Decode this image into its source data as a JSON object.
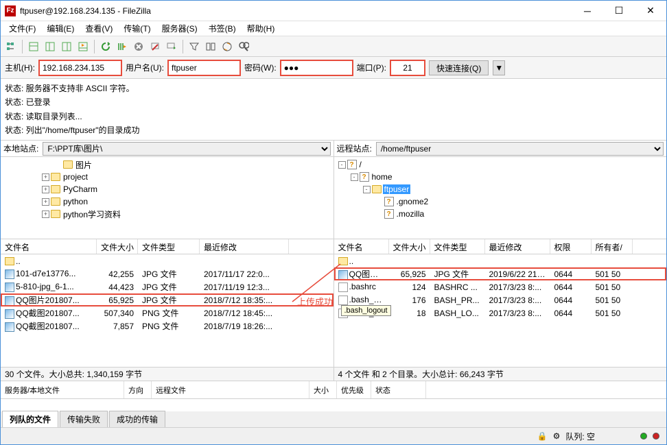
{
  "title": "ftpuser@192.168.234.135 - FileZilla",
  "menu": [
    "文件(F)",
    "编辑(E)",
    "查看(V)",
    "传输(T)",
    "服务器(S)",
    "书签(B)",
    "帮助(H)"
  ],
  "qc": {
    "host_label": "主机(H):",
    "host": "192.168.234.135",
    "user_label": "用户名(U):",
    "user": "ftpuser",
    "pass_label": "密码(W):",
    "pass": "●●●",
    "port_label": "端口(P):",
    "port": "21",
    "connect": "快速连接(Q)"
  },
  "log": [
    "状态:\t服务器不支持非 ASCII 字符。",
    "状态:\t已登录",
    "状态:\t读取目录列表...",
    "状态:\t列出\"/home/ftpuser\"的目录成功"
  ],
  "local_site_label": "本地站点:",
  "local_site": "F:\\PPT库\\图片\\",
  "remote_site_label": "远程站点:",
  "remote_site": "/home/ftpuser",
  "local_tree": [
    {
      "indent": 4,
      "exp": "",
      "label": "图片"
    },
    {
      "indent": 3,
      "exp": "+",
      "label": "project"
    },
    {
      "indent": 3,
      "exp": "+",
      "label": "PyCharm"
    },
    {
      "indent": 3,
      "exp": "+",
      "label": "python"
    },
    {
      "indent": 3,
      "exp": "+",
      "label": "python学习资料"
    }
  ],
  "remote_tree": [
    {
      "indent": 0,
      "exp": "-",
      "icon": "q",
      "label": "/"
    },
    {
      "indent": 1,
      "exp": "-",
      "icon": "q",
      "label": "home"
    },
    {
      "indent": 2,
      "exp": "-",
      "icon": "f",
      "label": "ftpuser",
      "selected": true
    },
    {
      "indent": 3,
      "exp": "",
      "icon": "q",
      "label": ".gnome2"
    },
    {
      "indent": 3,
      "exp": "",
      "icon": "q",
      "label": ".mozilla"
    }
  ],
  "lcols": [
    "文件名",
    "文件大小",
    "文件类型",
    "最近修改"
  ],
  "rcols": [
    "文件名",
    "文件大小",
    "文件类型",
    "最近修改",
    "权限",
    "所有者/"
  ],
  "lfiles": [
    {
      "up": true,
      "name": ".."
    },
    {
      "name": "101-d7e13776...",
      "size": "42,255",
      "type": "JPG 文件",
      "mod": "2017/11/17 22:0..."
    },
    {
      "name": "5-810-jpg_6-1...",
      "size": "44,423",
      "type": "JPG 文件",
      "mod": "2017/11/19 12:3..."
    },
    {
      "name": "QQ图片201807...",
      "size": "65,925",
      "type": "JPG 文件",
      "mod": "2018/7/12 18:35:...",
      "hl": true
    },
    {
      "name": "QQ截图201807...",
      "size": "507,340",
      "type": "PNG 文件",
      "mod": "2018/7/12 18:45:..."
    },
    {
      "name": "QQ截图201807...",
      "size": "7,857",
      "type": "PNG 文件",
      "mod": "2018/7/19 18:26:..."
    }
  ],
  "lstatus": "30 个文件。大小总共: 1,340,159 字节",
  "rfiles": [
    {
      "up": true,
      "name": ".."
    },
    {
      "name": "QQ图片...",
      "size": "65,925",
      "type": "JPG 文件",
      "mod": "2019/6/22 21:...",
      "perm": "0644",
      "own": "501 50",
      "hl": true
    },
    {
      "name": ".bashrc",
      "size": "124",
      "type": "BASHRC ...",
      "mod": "2017/3/23 8:...",
      "perm": "0644",
      "own": "501 50"
    },
    {
      "name": ".bash_p...",
      "size": "176",
      "type": "BASH_PR...",
      "mod": "2017/3/23 8:...",
      "perm": "0644",
      "own": "501 50"
    },
    {
      "name": ".bash_logout",
      "size": "18",
      "type": "BASH_LO...",
      "mod": "2017/3/23 8:...",
      "perm": "0644",
      "own": "501 50",
      "tooltip": ".bash_logout"
    }
  ],
  "rstatus": "4 个文件 和 2 个目录。大小总计: 66,243 字节",
  "qcols": [
    "服务器/本地文件",
    "方向",
    "远程文件",
    "大小",
    "优先级",
    "状态"
  ],
  "tabs": [
    "列队的文件",
    "传输失败",
    "成功的传输"
  ],
  "sb_queue": "队列: 空",
  "annot": "上传成功"
}
